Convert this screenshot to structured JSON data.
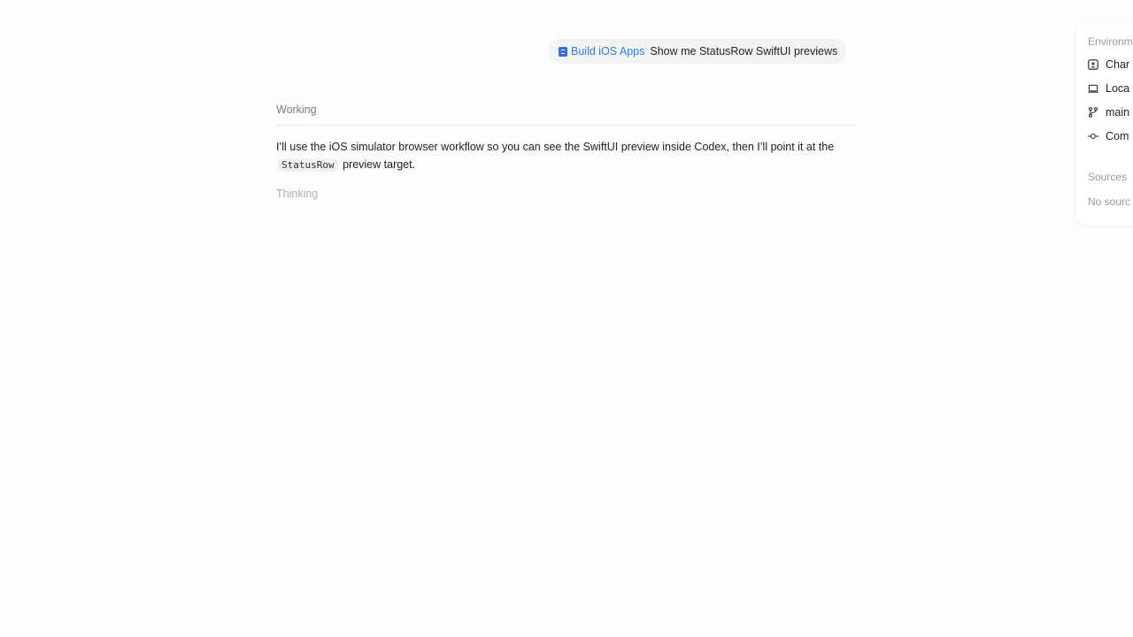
{
  "user_message": {
    "skill_label": "Build iOS Apps",
    "text": "Show me StatusRow SwiftUI previews"
  },
  "status": {
    "working_label": "Working",
    "thinking_label": "Thinking"
  },
  "assistant": {
    "text_before_code": "I’ll use the iOS simulator browser workflow so you can see the SwiftUI preview inside Codex, then I’ll point it at the",
    "code": "StatusRow",
    "text_after_code": "preview target."
  },
  "side_panel": {
    "environment_heading": "Environm",
    "items": [
      {
        "icon": "changes-icon",
        "label": "Char"
      },
      {
        "icon": "laptop-icon",
        "label": "Loca"
      },
      {
        "icon": "branch-icon",
        "label": "main"
      },
      {
        "icon": "commit-icon",
        "label": "Com"
      }
    ],
    "sources_heading": "Sources",
    "sources_empty": "No sourc"
  },
  "colors": {
    "background": "#fdfdfd",
    "skill_link": "#2f7fd6",
    "skill_icon": "#3b6fd8",
    "muted": "#7b7b7b",
    "faint": "#b0b0b0"
  }
}
